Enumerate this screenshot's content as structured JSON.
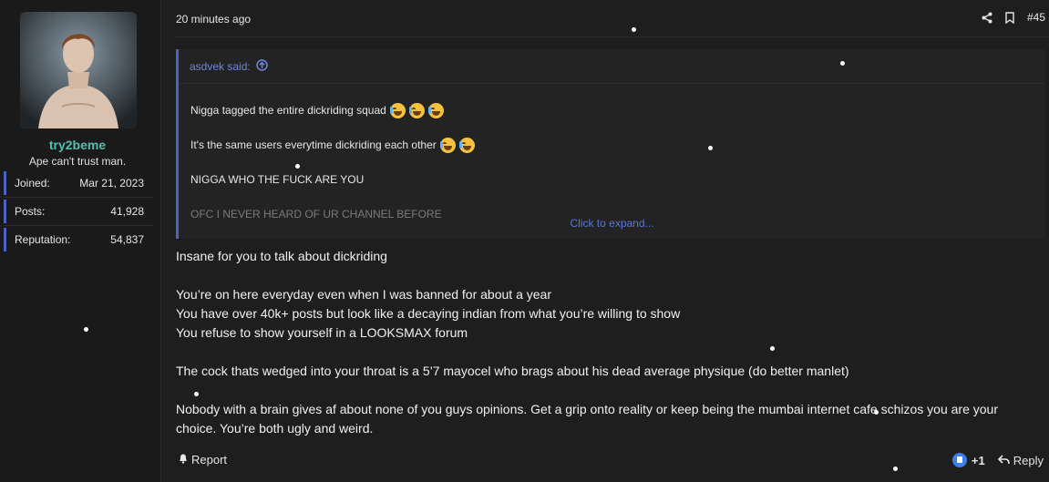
{
  "user": {
    "username": "try2beme",
    "title": "Ape can't trust man.",
    "stats": [
      {
        "label": "Joined:",
        "value": "Mar 21, 2023"
      },
      {
        "label": "Posts:",
        "value": "41,928"
      },
      {
        "label": "Reputation:",
        "value": "54,837"
      }
    ]
  },
  "post": {
    "time": "20 minutes ago",
    "number": "#45",
    "quote": {
      "author_line": "asdvek said:",
      "lines": [
        "Nigga tagged the entire dickriding squad",
        "It's the same users everytime dickriding each other",
        "NIGGA WHO THE FUCK ARE YOU",
        "OFC I NEVER HEARD OF UR CHANNEL BEFORE"
      ],
      "expand_label": "Click to expand..."
    },
    "message": [
      "Insane for you to talk about dickriding",
      "",
      "You’re on here everyday even when I was banned for about a year",
      "You have over 40k+ posts but look like a decaying indian from what you’re willing to show",
      "You refuse to show yourself in a LOOKSMAX forum",
      "",
      "The cock thats wedged into your throat is a 5’7 mayocel who brags about his dead average physique (do better manlet)",
      "",
      "Nobody with a brain gives af about none of you guys opinions. Get a grip onto reality or keep being the mumbai internet cafe schizos you are your choice. You’re both ugly and weird."
    ],
    "footer": {
      "report_label": "Report",
      "reaction_count": "+1",
      "reply_label": "Reply"
    }
  },
  "icons": {
    "share": "share-icon",
    "bookmark": "bookmark-icon",
    "quote_jump": "arrow-up-circle-icon",
    "report": "bell-icon",
    "reply": "reply-icon",
    "reaction": "like-reaction-icon"
  },
  "colors": {
    "accent": "#4a63c8",
    "username": "#4fc0b0",
    "link": "#5c76d8",
    "background": "#1e1e1f"
  }
}
